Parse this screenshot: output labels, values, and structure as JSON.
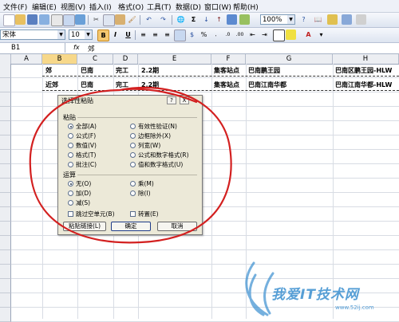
{
  "menu": [
    "文件(F)",
    "编辑(E)",
    "视图(V)",
    "插入(I)",
    "格式(O)",
    "工具(T)",
    "数据(D)",
    "窗口(W)",
    "帮助(H)"
  ],
  "toolbar": {
    "zoom": "100%",
    "font_name": "宋体",
    "font_size": "10",
    "bold": "B",
    "italic": "I",
    "underline": "U",
    "currency": "%",
    "sum": "Σ",
    "sort": "↓"
  },
  "formula": {
    "name_box": "B1",
    "fx": "fx",
    "value": "郊"
  },
  "columns": [
    "A",
    "B",
    "C",
    "D",
    "E",
    "F",
    "G",
    "H"
  ],
  "rows": [
    "",
    "",
    "",
    "",
    "",
    "",
    "",
    "",
    "",
    "",
    "",
    "",
    "",
    "",
    "",
    "",
    "",
    "",
    "",
    "",
    "",
    "",
    "",
    "",
    "",
    ""
  ],
  "sheet": {
    "row1": [
      "郊",
      "巴南",
      "完工",
      "2.2期",
      "集客站点",
      "巴南鹏王园",
      "巴南区鹏王园-HLW"
    ],
    "row2": [
      "近郊",
      "巴南",
      "完工",
      "2.2期",
      "集客站点",
      "巴南江南华都",
      "巴南江南华都-HLW"
    ]
  },
  "dialog": {
    "title": "选择性粘贴",
    "help": "?",
    "close": "X",
    "paste_group": "粘贴",
    "paste_options": [
      "全部(A)",
      "公式(F)",
      "数值(V)",
      "格式(T)",
      "批注(C)"
    ],
    "paste_options_right": [
      "有效性验证(N)",
      "边框除外(X)",
      "列宽(W)",
      "公式和数字格式(R)",
      "值和数字格式(U)"
    ],
    "operation_group": "运算",
    "operation_options": [
      "无(O)",
      "加(D)",
      "减(S)"
    ],
    "operation_options_right": [
      "乘(M)",
      "除(I)"
    ],
    "skip_blanks": "跳过空单元(B)",
    "transpose": "转置(E)",
    "paste_link_button": "粘贴链接(L)",
    "ok_button": "确定",
    "cancel_button": "取消"
  },
  "watermark": {
    "text": "我爱IT技术网",
    "url": "www.52ij.com"
  },
  "colors": {
    "annotation_red": "#d32020",
    "watermark_blue": "#3a8fd0"
  }
}
